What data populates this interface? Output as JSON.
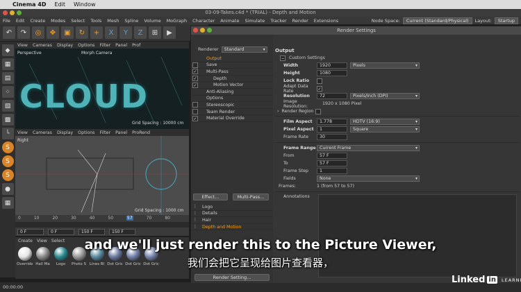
{
  "mac_menubar": {
    "apple": "",
    "app": "Cinema 4D",
    "items": [
      "Edit",
      "Window"
    ]
  },
  "window": {
    "title": "03-09-Takes.c4d * (TRIAL) - Depth and Motion"
  },
  "app_menu": {
    "items": [
      "File",
      "Edit",
      "Create",
      "Modes",
      "Select",
      "Tools",
      "Mesh",
      "Spline",
      "Volume",
      "MoGraph",
      "Character",
      "Animate",
      "Simulate",
      "Tracker",
      "Render",
      "Extensions"
    ],
    "node_space_label": "Node Space:",
    "node_space_value": "Current (Standard/Physical)",
    "layout_label": "Layout:",
    "layout_value": "Startup"
  },
  "toolbar": {
    "axes": [
      "X",
      "Y",
      "Z"
    ]
  },
  "viewport_top": {
    "menu": [
      "View",
      "Cameras",
      "Display",
      "Options",
      "Filter",
      "Panel",
      "Prof"
    ],
    "label": "Perspective",
    "camera": "Morph Camera",
    "scene_text": "CLOUD",
    "grid": "Grid Spacing : 10000 cm"
  },
  "viewport_bottom": {
    "menu": [
      "View",
      "Cameras",
      "Display",
      "Options",
      "Filter",
      "Panel",
      "ProRend"
    ],
    "label": "Right",
    "grid": "Grid Spacing : 1000 cm"
  },
  "timeline": {
    "ticks": [
      "0",
      "10",
      "20",
      "30",
      "40",
      "50",
      "57",
      "70",
      "80"
    ],
    "start": "0 F",
    "current": "0 F",
    "end": "150 F",
    "end2": "150 F"
  },
  "materials": {
    "menu": [
      "Create",
      "View",
      "Select"
    ],
    "items": [
      {
        "name": "Override",
        "color": "#e6e6e6"
      },
      {
        "name": "Hall Ma",
        "color": "#8a8a8a"
      },
      {
        "name": "Logo",
        "color": "#2a8a90"
      },
      {
        "name": "Photo S",
        "color": "#9a9a9a"
      },
      {
        "name": "Lines Bl",
        "color": "#5a8aa0"
      },
      {
        "name": "Dot Gric",
        "color": "#6a7aa0"
      },
      {
        "name": "Dot Gric",
        "color": "#7080a8"
      },
      {
        "name": "Dot Gric",
        "color": "#7484aa"
      }
    ]
  },
  "status": {
    "time": "00:00:00"
  },
  "render_settings": {
    "title": "Render Settings",
    "renderer_label": "Renderer",
    "renderer_value": "Standard",
    "tree": [
      {
        "label": "Output",
        "checkbox": "none",
        "active": true,
        "indent": 0
      },
      {
        "label": "Save",
        "checkbox": "off",
        "active": false,
        "indent": 0
      },
      {
        "label": "Multi-Pass",
        "checkbox": "on",
        "active": false,
        "indent": 0
      },
      {
        "label": "Depth",
        "checkbox": "on",
        "active": false,
        "indent": 1
      },
      {
        "label": "Motion Vector",
        "checkbox": "on",
        "active": false,
        "indent": 1
      },
      {
        "label": "Anti-Aliasing",
        "checkbox": "none",
        "active": false,
        "indent": 0
      },
      {
        "label": "Options",
        "checkbox": "none",
        "active": false,
        "indent": 0
      },
      {
        "label": "Stereoscopic",
        "checkbox": "off",
        "active": false,
        "indent": 0
      },
      {
        "label": "Team Render",
        "checkbox": "off",
        "active": false,
        "indent": 0
      },
      {
        "label": "Material Override",
        "checkbox": "on",
        "active": false,
        "indent": 0
      }
    ],
    "effect_button": "Effect...",
    "multipass_button": "Multi-Pass...",
    "takes": [
      {
        "label": "Logo",
        "active": false
      },
      {
        "label": "Details",
        "active": false
      },
      {
        "label": "Hair",
        "active": false
      },
      {
        "label": "Depth and Motion",
        "active": true
      }
    ],
    "render_setting_button": "Render Setting...",
    "output": {
      "heading": "Output",
      "preset": "Custom Settings",
      "width_label": "Width",
      "width": "1920",
      "unit": "Pixels",
      "height_label": "Height",
      "height": "1080",
      "lock_ratio_label": "Lock Ratio",
      "adapt_label": "Adapt Data Rate",
      "resolution_label": "Resolution",
      "resolution": "72",
      "res_unit": "Pixels/Inch (DPI)",
      "image_res_label": "Image Resolution:",
      "image_res": "1920 x 1080 Pixel",
      "render_region_label": "Render Region",
      "film_aspect_label": "Film Aspect",
      "film_aspect": "1.778",
      "film_aspect_preset": "HDTV (16:9)",
      "pixel_aspect_label": "Pixel Aspect",
      "pixel_aspect": "1",
      "pixel_aspect_preset": "Square",
      "frame_rate_label": "Frame Rate",
      "frame_rate": "30",
      "frame_range_label": "Frame Range",
      "frame_range": "Current Frame",
      "from_label": "From",
      "from": "57 F",
      "to_label": "To",
      "to": "57 F",
      "frame_step_label": "Frame Step",
      "frame_step": "1",
      "fields_label": "Fields",
      "fields": "None",
      "frames_label": "Frames:",
      "frames": "1 (from 57 to 57)",
      "annotations_label": "Annotations"
    }
  },
  "subtitles": {
    "en": "and we'll just render this to the Picture Viewer,",
    "cn": "我们会把它呈现给图片查看器，"
  },
  "watermark": {
    "linked": "Linked",
    "in": "in",
    "learning": "LEARNING"
  }
}
